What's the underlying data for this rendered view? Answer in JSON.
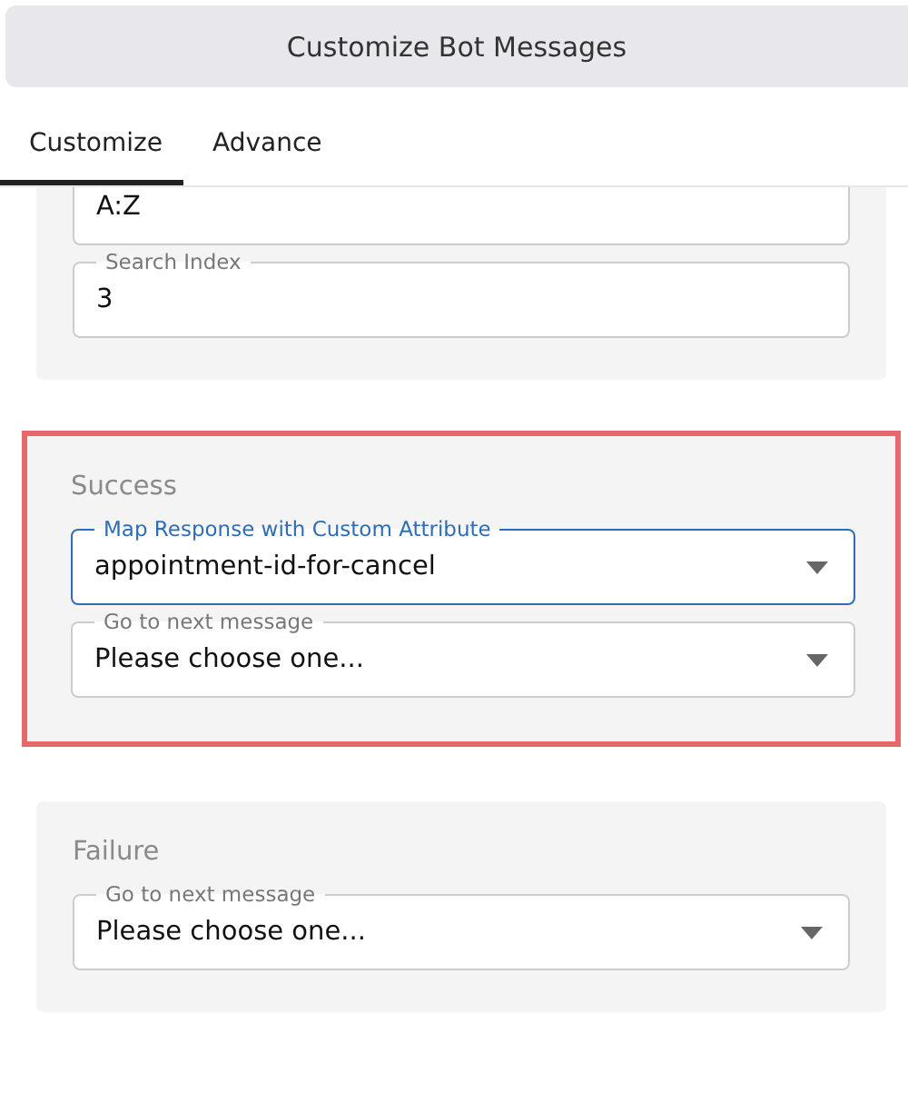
{
  "header": {
    "title": "Customize Bot Messages"
  },
  "tabs": [
    {
      "label": "Customize",
      "selected": true
    },
    {
      "label": "Advance",
      "selected": false
    }
  ],
  "cards": [
    {
      "highlighted": false,
      "fields": [
        {
          "kind": "text",
          "value": "A:Z",
          "focused": false
        },
        {
          "kind": "text",
          "label": "Search Index",
          "value": "3",
          "focused": false
        }
      ]
    },
    {
      "heading": "Success",
      "highlighted": true,
      "fields": [
        {
          "kind": "select",
          "label": "Map Response with Custom Attribute",
          "value": "appointment-id-for-cancel",
          "focused": true
        },
        {
          "kind": "select",
          "label": "Go to next message",
          "value": "Please choose one...",
          "focused": false
        }
      ]
    },
    {
      "heading": "Failure",
      "highlighted": false,
      "fields": [
        {
          "kind": "select",
          "label": "Go to next message",
          "value": "Please choose one...",
          "focused": false
        }
      ]
    }
  ]
}
